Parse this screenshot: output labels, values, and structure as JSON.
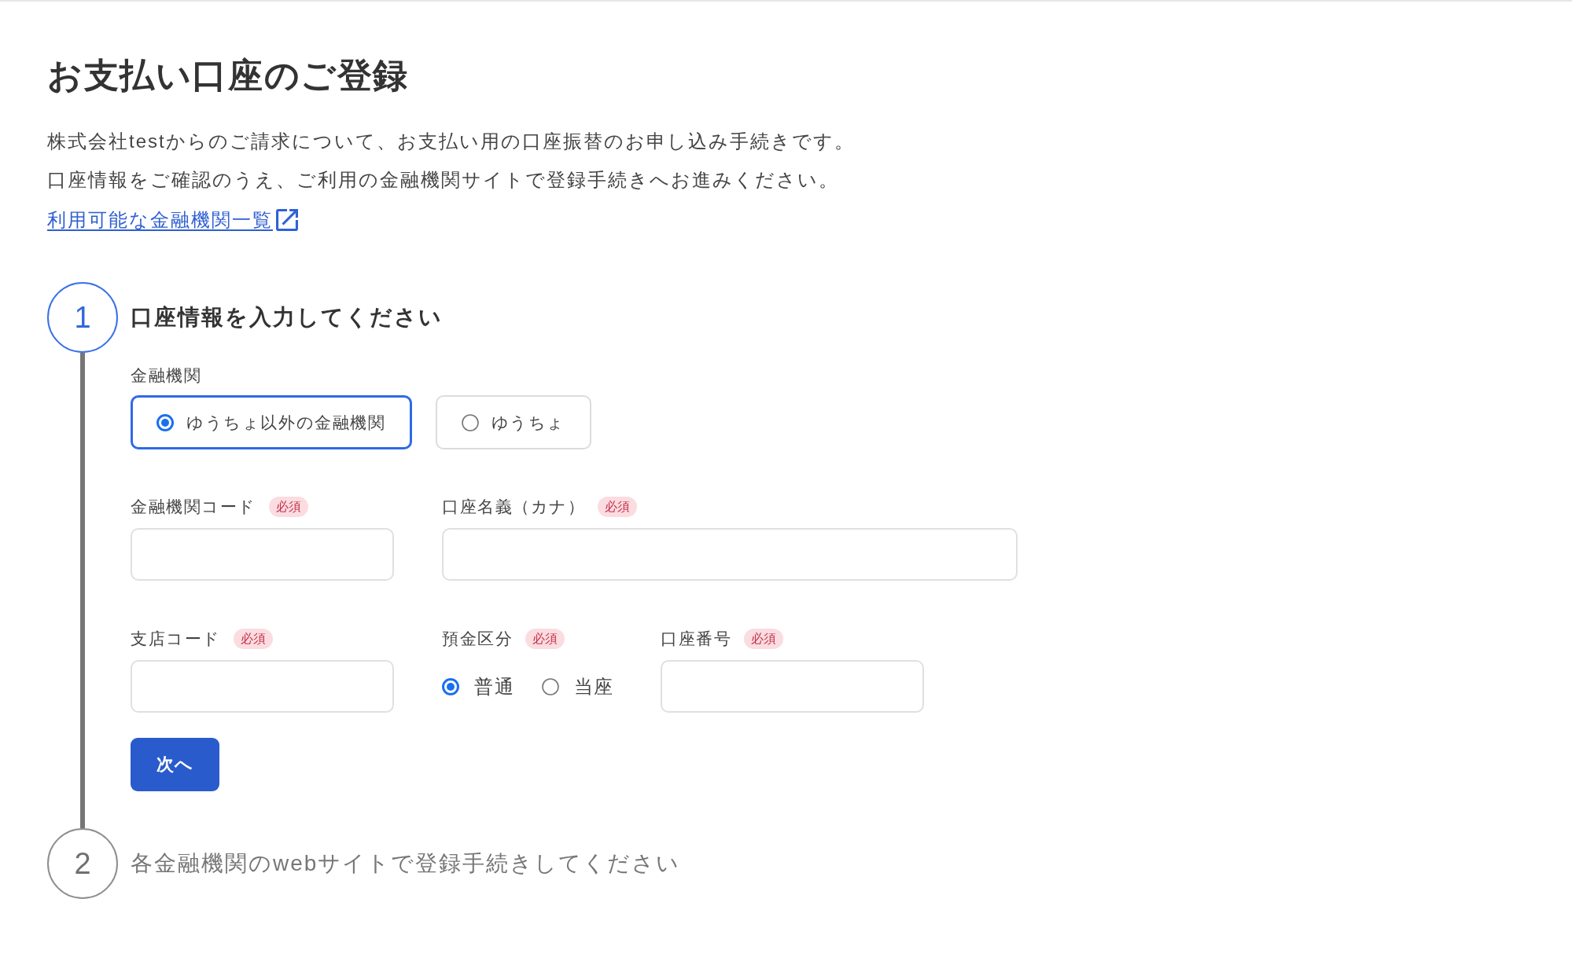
{
  "header": {
    "title": "お支払い口座のご登録",
    "description": [
      "株式会社testからのご請求について、お支払い用の口座振替のお申し込み手続きです。",
      "口座情報をご確認のうえ、ご利用の金融機関サイトで登録手続きへお進みください。"
    ],
    "link": {
      "label": "利用可能な金融機関一覧",
      "external": true
    }
  },
  "steps": [
    {
      "number": "1",
      "title": "口座情報を入力してください",
      "active": true,
      "form": {
        "institution": {
          "label": "金融機関",
          "options": [
            {
              "label": "ゆうちょ以外の金融機関",
              "selected": true
            },
            {
              "label": "ゆうちょ",
              "selected": false
            }
          ]
        },
        "rows": [
          [
            {
              "kind": "text",
              "label": "金融機関コード",
              "badge": "必須"
            },
            {
              "kind": "text",
              "label": "口座名義（カナ）",
              "badge": "必須"
            }
          ],
          [
            {
              "kind": "text",
              "label": "支店コード",
              "badge": "必須"
            },
            {
              "kind": "radio",
              "label": "預金区分",
              "badge": "必須",
              "options": [
                {
                  "label": "普通",
                  "selected": true
                },
                {
                  "label": "当座",
                  "selected": false
                }
              ]
            },
            {
              "kind": "text",
              "label": "口座番号",
              "badge": "必須"
            }
          ]
        ],
        "button": {
          "label": "次へ"
        }
      }
    },
    {
      "number": "2",
      "title": "各金融機関のwebサイトで登録手続きしてください",
      "active": false
    }
  ]
}
